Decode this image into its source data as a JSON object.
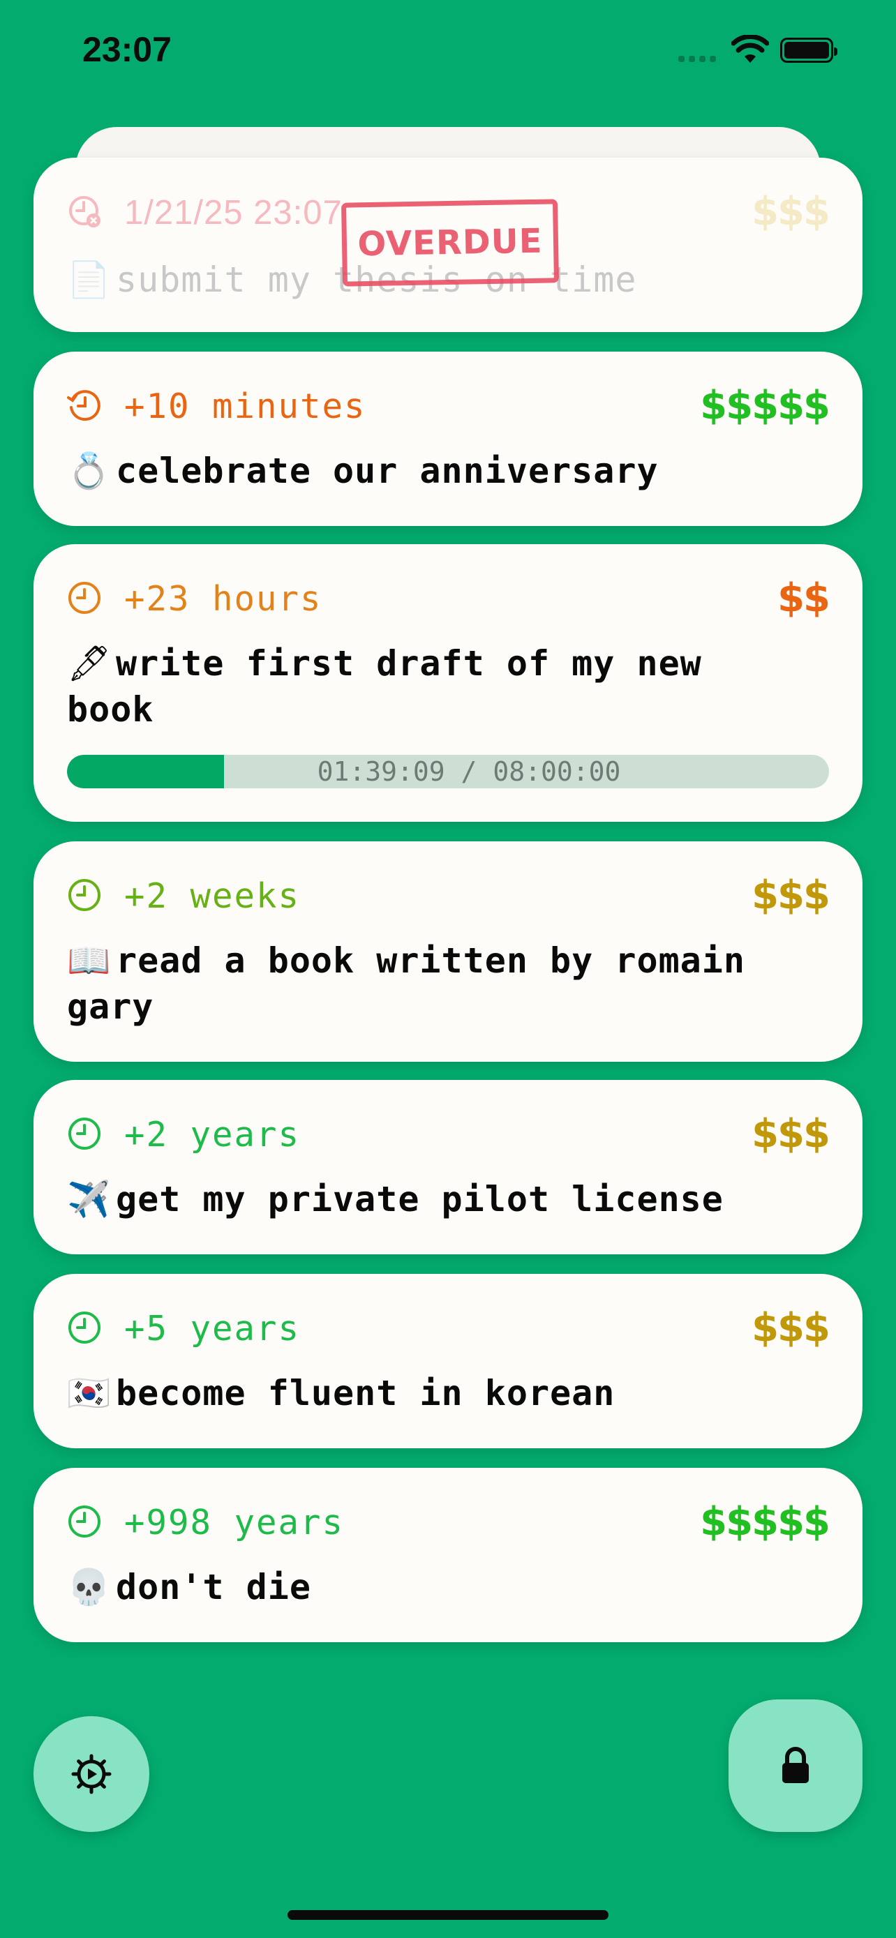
{
  "status_bar": {
    "time": "23:07"
  },
  "tasks": [
    {
      "due": "1/21/25 23:07",
      "cost": "$$$",
      "emoji": "📄",
      "title": "submit my thesis on time",
      "stamp": "OVERDUE",
      "cost_color": "#f5eac6",
      "due_color": "#f6b9c0",
      "icon": "clock-overdue-icon"
    },
    {
      "due": "+10 minutes",
      "cost": "$$$$$",
      "emoji": "💍",
      "title": "celebrate our anniversary",
      "cost_color": "#22bf22",
      "due_color": "#ea6512",
      "icon": "clock-snooze-icon"
    },
    {
      "due": "+23 hours",
      "cost": "$$",
      "emoji": "🖋",
      "title": "write first draft of my new book",
      "cost_color": "#ea6512",
      "due_color": "#e4821a",
      "icon": "clock-icon",
      "progress": {
        "text": "01:39:09 / 08:00:00",
        "fraction": 0.206
      }
    },
    {
      "due": "+2 weeks",
      "cost": "$$$",
      "emoji": "📖",
      "title": "read a book written by romain gary",
      "cost_color": "#c1980a",
      "due_color": "#66b116",
      "icon": "clock-icon"
    },
    {
      "due": "+2 years",
      "cost": "$$$",
      "emoji": "✈️",
      "title": "get my private pilot license",
      "cost_color": "#c1980a",
      "due_color": "#1fbb4a",
      "icon": "clock-icon"
    },
    {
      "due": "+5 years",
      "cost": "$$$",
      "emoji": "🇰🇷",
      "title": "become fluent in korean",
      "cost_color": "#c1980a",
      "due_color": "#1fbb4a",
      "icon": "clock-icon"
    },
    {
      "due": "+998 years",
      "cost": "$$$$$",
      "emoji": "💀",
      "title": "don't die",
      "cost_color": "#22bf22",
      "due_color": "#1fbb4a",
      "icon": "clock-icon"
    }
  ],
  "buttons": {
    "settings_icon": "gear-icon",
    "lock_icon": "lock-icon"
  }
}
